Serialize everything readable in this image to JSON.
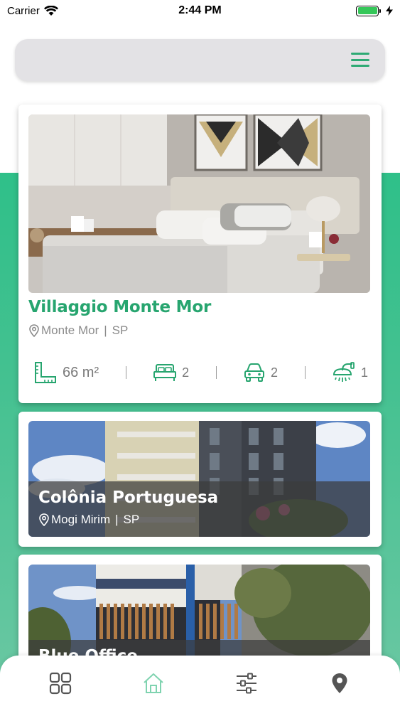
{
  "status_bar": {
    "carrier": "Carrier",
    "time": "2:44 PM",
    "battery_level": 1.0
  },
  "colors": {
    "brand_green": "#27a56f",
    "background_green": "#2fc089",
    "menu_green": "#2eaa74"
  },
  "header": {
    "menu_icon": "hamburger-menu-icon"
  },
  "listings": [
    {
      "title": "Villaggio Monte Mor",
      "city": "Monte Mor",
      "state": "SP",
      "area": "66 m²",
      "bedrooms": "2",
      "parking": "2",
      "bathrooms": "1"
    },
    {
      "title": "Colônia Portuguesa",
      "city": "Mogi Mirim",
      "state": "SP"
    },
    {
      "title": "Blue Office"
    }
  ],
  "bottom_nav": {
    "items": [
      {
        "icon": "grid-icon",
        "active": false
      },
      {
        "icon": "home-icon",
        "active": true
      },
      {
        "icon": "sliders-icon",
        "active": false
      },
      {
        "icon": "map-pin-icon",
        "active": false
      }
    ]
  }
}
